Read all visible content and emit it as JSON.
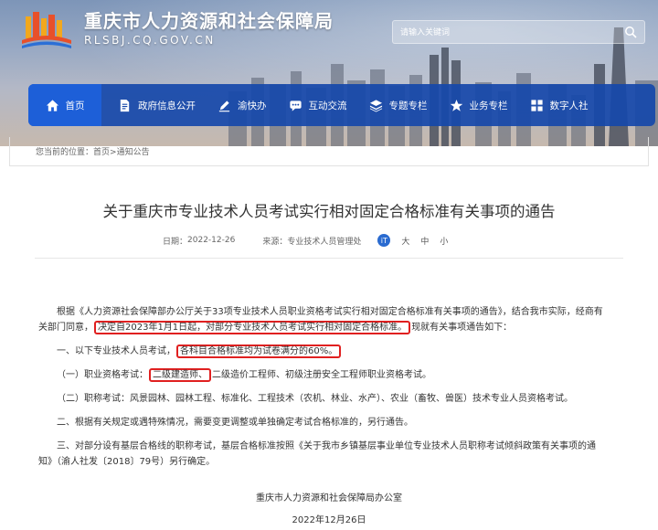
{
  "header": {
    "site_title_cn": "重庆市人力资源和社会保障局",
    "site_title_en": "RLSBJ.CQ.GOV.CN",
    "search_placeholder": "请输入关键词"
  },
  "nav": [
    {
      "label": "首页",
      "icon": "home-icon",
      "active": true
    },
    {
      "label": "政府信息公开",
      "icon": "document-icon"
    },
    {
      "label": "渝快办",
      "icon": "pen-icon"
    },
    {
      "label": "互动交流",
      "icon": "chat-icon"
    },
    {
      "label": "专题专栏",
      "icon": "layers-icon"
    },
    {
      "label": "业务专栏",
      "icon": "star-icon"
    },
    {
      "label": "数字人社",
      "icon": "grid-icon"
    }
  ],
  "breadcrumb": {
    "prefix": "您当前的位置：",
    "home": "首页",
    "separator": ">",
    "current": "通知公告"
  },
  "article": {
    "title": "关于重庆市专业技术人员考试实行相对固定合格标准有关事项的通告",
    "date_label": "日期：",
    "date": "2022-12-26",
    "source_label": "来源：",
    "source": "专业技术人员管理处",
    "font_large": "大",
    "font_medium": "中",
    "font_small": "小",
    "share_glyph": "iT",
    "p1_a": "根据《人力资源社会保障部办公厅关于33项专业技术人员职业资格考试实行相对固定合格标准有关事项的通告》，结合我市实际，经商有关部门同意，",
    "p1_hl": "决定自2023年1月1日起，对部分专业技术人员考试实行相对固定合格标准。",
    "p1_b": "现就有关事项通告如下：",
    "p2_a": "一、以下专业技术人员考试，",
    "p2_hl": "各科目合格标准均为试卷满分的60%。",
    "p3_a": "（一）职业资格考试：",
    "p3_hl": "二级建造师、",
    "p3_b": "二级造价工程师、初级注册安全工程师职业资格考试。",
    "p4": "（二）职称考试：风景园林、园林工程、标准化、工程技术（农机、林业、水产）、农业（畜牧、兽医）技术专业人员资格考试。",
    "p5": "二、根据有关规定或遇特殊情况，需要变更调整或单独确定考试合格标准的，另行通告。",
    "p6": "三、对部分设有基层合格线的职称考试，基层合格标准按照《关于我市乡镇基层事业单位专业技术人员职称考试倾斜政策有关事项的通知》（渝人社发〔2018〕79号）另行确定。",
    "sign_org": "重庆市人力资源和社会保障局办公室",
    "sign_date": "2022年12月26日"
  },
  "colors": {
    "nav_bg": "#1648aa",
    "nav_active": "#1d5fd8",
    "highlight": "#e02020"
  }
}
